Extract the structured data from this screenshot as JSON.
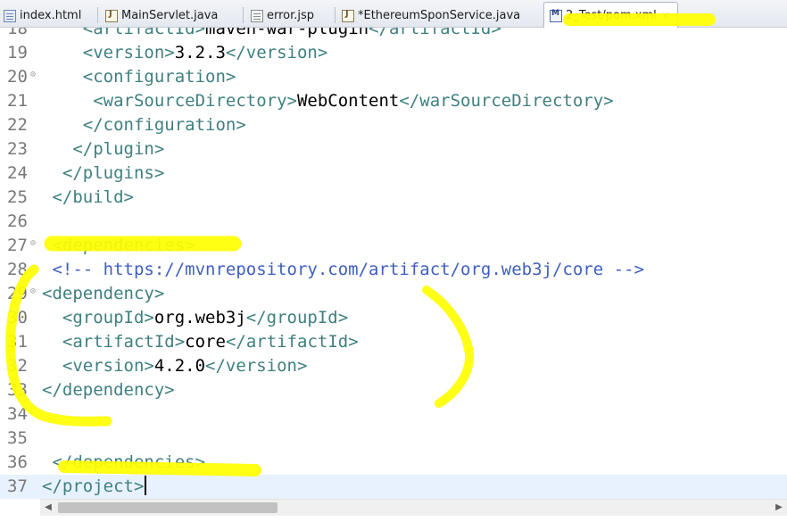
{
  "tabs": [
    {
      "label": "index.html",
      "icon": "html-file-icon"
    },
    {
      "label": "MainServlet.java",
      "icon": "java-file-icon"
    },
    {
      "label": "error.jsp",
      "icon": "jsp-file-icon"
    },
    {
      "label": "*EthereumSponService.java",
      "icon": "java-file-icon"
    },
    {
      "label": "2_Test/pom.xml",
      "icon": "xml-file-icon",
      "active": true,
      "close": "⨯"
    }
  ],
  "lines": [
    {
      "num": "18",
      "indent": "    ",
      "parts": [
        {
          "c": "t",
          "v": "<artifactId>"
        },
        {
          "c": "tx",
          "v": "maven-war-plugin"
        },
        {
          "c": "t",
          "v": "</artifactId>"
        }
      ]
    },
    {
      "num": "19",
      "indent": "    ",
      "parts": [
        {
          "c": "t",
          "v": "<version>"
        },
        {
          "c": "tx",
          "v": "3.2.3"
        },
        {
          "c": "t",
          "v": "</version>"
        }
      ]
    },
    {
      "num": "20",
      "fold": true,
      "indent": "    ",
      "parts": [
        {
          "c": "t",
          "v": "<configuration>"
        }
      ]
    },
    {
      "num": "21",
      "indent": "     ",
      "parts": [
        {
          "c": "t",
          "v": "<warSourceDirectory>"
        },
        {
          "c": "tx",
          "v": "WebContent"
        },
        {
          "c": "t",
          "v": "</warSourceDirectory>"
        }
      ]
    },
    {
      "num": "22",
      "indent": "    ",
      "parts": [
        {
          "c": "t",
          "v": "</configuration>"
        }
      ]
    },
    {
      "num": "23",
      "indent": "   ",
      "parts": [
        {
          "c": "t",
          "v": "</plugin>"
        }
      ]
    },
    {
      "num": "24",
      "indent": "  ",
      "parts": [
        {
          "c": "t",
          "v": "</plugins>"
        }
      ]
    },
    {
      "num": "25",
      "indent": " ",
      "parts": [
        {
          "c": "t",
          "v": "</build>"
        }
      ]
    },
    {
      "num": "26",
      "indent": "",
      "parts": []
    },
    {
      "num": "27",
      "fold": true,
      "indent": " ",
      "parts": [
        {
          "c": "t",
          "v": "<dependencies>"
        }
      ]
    },
    {
      "num": "28",
      "indent": " ",
      "parts": [
        {
          "c": "cm",
          "v": "<!-- https://mvnrepository.com/artifact/org.web3j/core -->"
        }
      ]
    },
    {
      "num": "29",
      "fold": true,
      "indent": "",
      "parts": [
        {
          "c": "t",
          "v": "<dependency>"
        }
      ]
    },
    {
      "num": "30",
      "indent": "  ",
      "parts": [
        {
          "c": "t",
          "v": "<groupId>"
        },
        {
          "c": "tx",
          "v": "org.web3j"
        },
        {
          "c": "t",
          "v": "</groupId>"
        }
      ]
    },
    {
      "num": "31",
      "indent": "  ",
      "parts": [
        {
          "c": "t",
          "v": "<artifactId>"
        },
        {
          "c": "tx",
          "v": "core"
        },
        {
          "c": "t",
          "v": "</artifactId>"
        }
      ]
    },
    {
      "num": "32",
      "indent": "  ",
      "parts": [
        {
          "c": "t",
          "v": "<version>"
        },
        {
          "c": "tx",
          "v": "4.2.0"
        },
        {
          "c": "t",
          "v": "</version>"
        }
      ]
    },
    {
      "num": "33",
      "indent": "",
      "parts": [
        {
          "c": "t",
          "v": "</dependency>"
        }
      ]
    },
    {
      "num": "34",
      "indent": "",
      "parts": []
    },
    {
      "num": "35",
      "indent": "",
      "parts": []
    },
    {
      "num": "36",
      "indent": " ",
      "parts": [
        {
          "c": "t",
          "v": "</dependencies>"
        }
      ]
    },
    {
      "num": "37",
      "indent": "",
      "current": true,
      "caret": true,
      "parts": [
        {
          "c": "t",
          "v": "</project>"
        }
      ]
    }
  ],
  "colors": {
    "tag": "#3f7f7f",
    "text": "#000000",
    "comment": "#3f5fbf",
    "line_number": "#787878",
    "current_line": "#e8f2fe",
    "highlighter": "#ffff00"
  },
  "scrollbar": {
    "left_arrow": "◀",
    "right_arrow": "▶"
  }
}
